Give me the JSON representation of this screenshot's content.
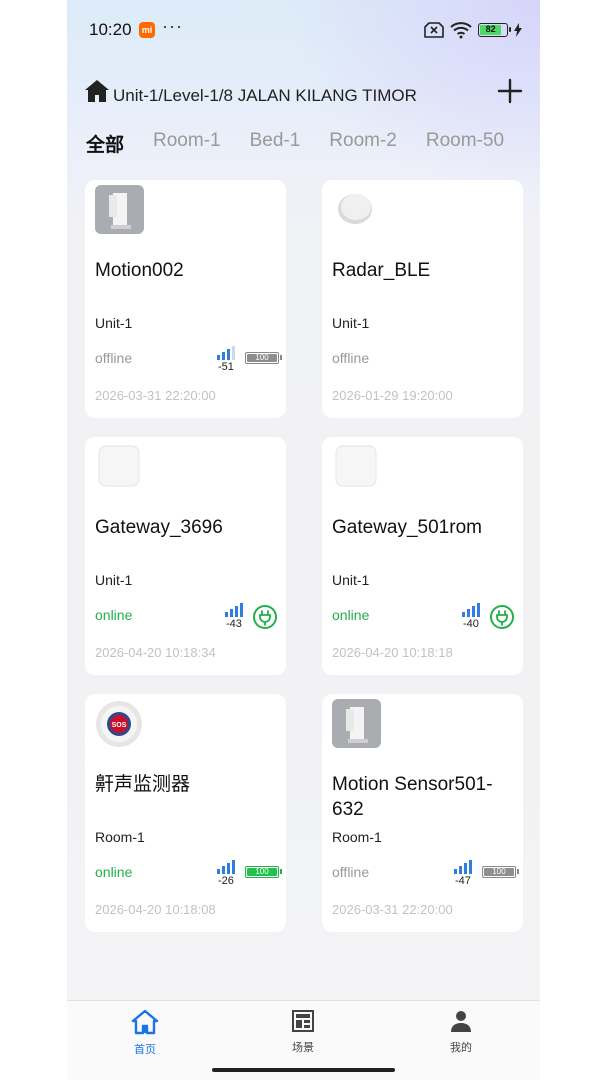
{
  "status_bar": {
    "time": "10:20",
    "battery": "82",
    "mi_badge": "mi",
    "dots": "···"
  },
  "header": {
    "location": "Unit-1/Level-1/8 JALAN KILANG TIMOR"
  },
  "tabs": [
    {
      "label": "全部",
      "active": true
    },
    {
      "label": "Room-1"
    },
    {
      "label": "Bed-1"
    },
    {
      "label": "Room-2"
    },
    {
      "label": "Room-50"
    }
  ],
  "devices": [
    {
      "name": "Motion002",
      "room": "Unit-1",
      "status": "offline",
      "rssi": "-51",
      "battery": "100",
      "date": "2026-03-31 22:20:00"
    },
    {
      "name": "Radar_BLE",
      "room": "Unit-1",
      "status": "offline",
      "date": "2026-01-29 19:20:00"
    },
    {
      "name": "Gateway_3696",
      "room": "Unit-1",
      "status": "online",
      "rssi": "-43",
      "date": "2026-04-20 10:18:34"
    },
    {
      "name": "Gateway_501rom",
      "room": "Unit-1",
      "status": "online",
      "rssi": "-40",
      "date": "2026-04-20 10:18:18"
    },
    {
      "name": "鼾声监测器",
      "room": "Room-1",
      "status": "online",
      "rssi": "-26",
      "battery": "100",
      "date": "2026-04-20 10:18:08"
    },
    {
      "name": "Motion Sensor501-632",
      "room": "Room-1",
      "status": "offline",
      "rssi": "-47",
      "battery": "100",
      "date": "2026-03-31 22:20:00"
    }
  ],
  "sos_label": "SOS",
  "tabbar": [
    {
      "label": "首页",
      "icon": "home-icon",
      "active": true
    },
    {
      "label": "场景",
      "icon": "scene-icon"
    },
    {
      "label": "我的",
      "icon": "profile-icon"
    }
  ],
  "colors": {
    "accent": "#1a73e8",
    "online": "#22b04a",
    "signal": "#2f7de1"
  }
}
